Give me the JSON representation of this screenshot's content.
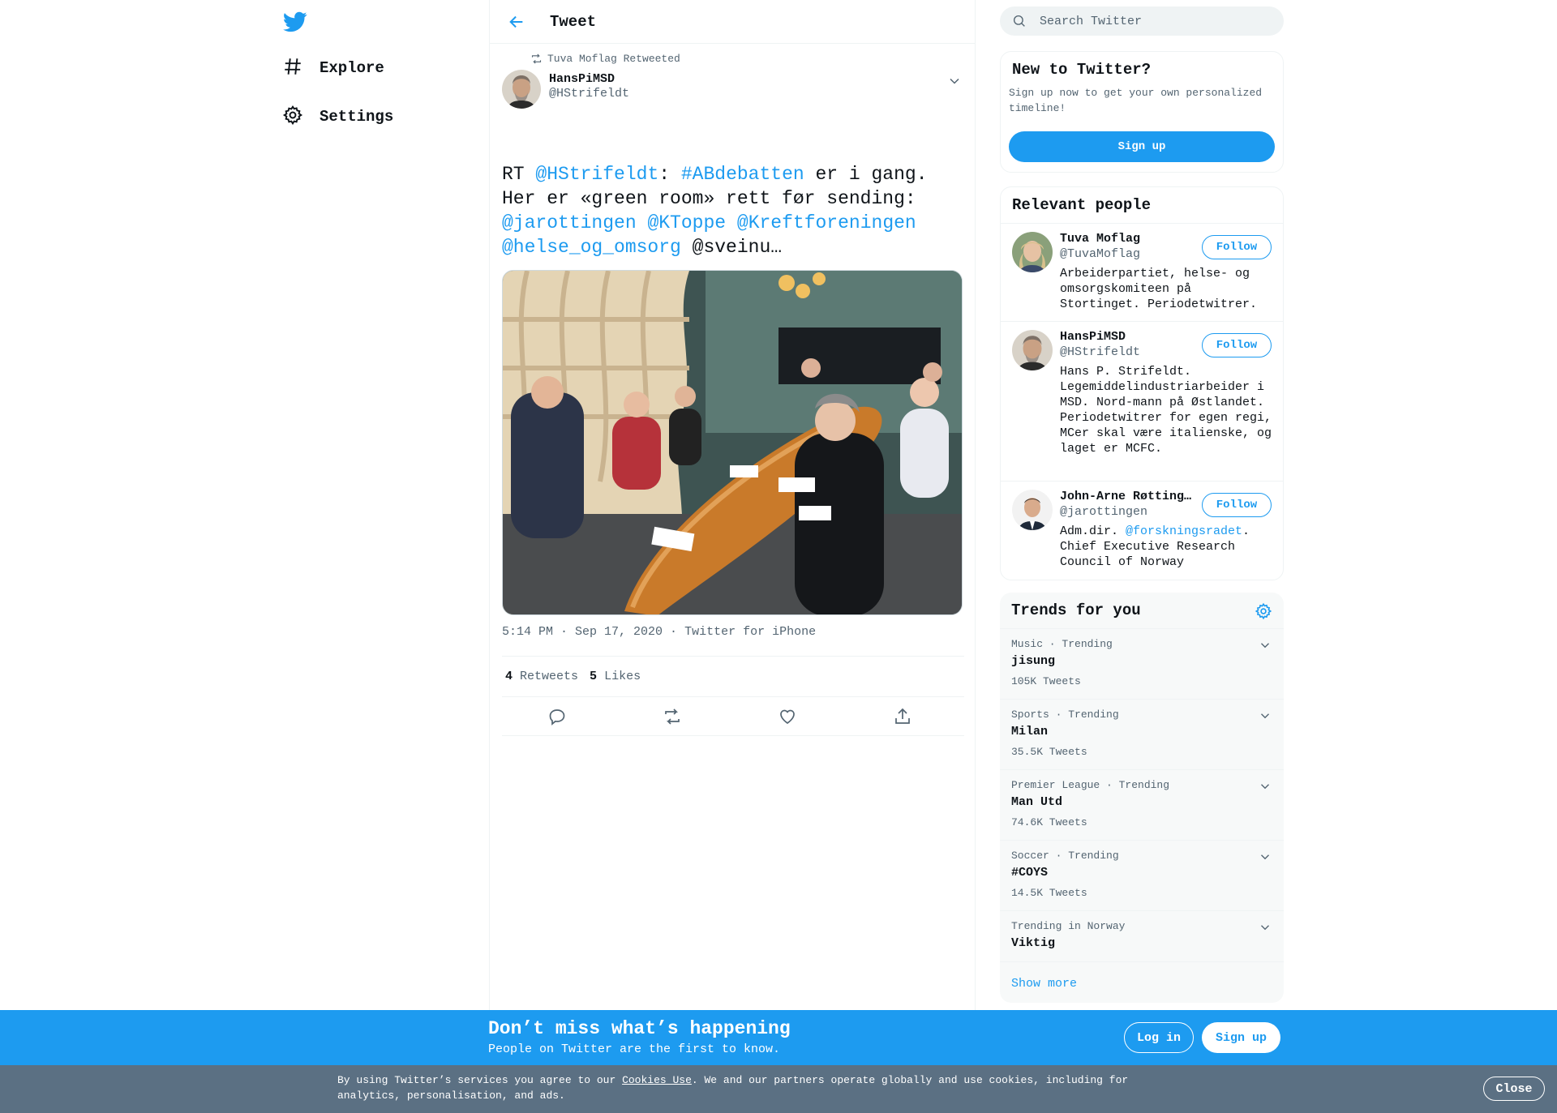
{
  "nav": {
    "logo_icon": "twitter-bird-icon",
    "items": [
      {
        "label": "Explore",
        "icon": "hashtag-icon"
      },
      {
        "label": "Settings",
        "icon": "gear-icon"
      }
    ]
  },
  "header": {
    "title": "Tweet",
    "back_icon": "arrow-left-icon"
  },
  "tweet": {
    "retweeted_by": "Tuva Moflag Retweeted",
    "author_name": "HansPiMSD",
    "author_handle": "@HStrifeldt",
    "text": {
      "rt": "RT ",
      "mention1": "@HStrifeldt",
      "colon": ": ",
      "hashtag": "#ABdebatten",
      "after_hashtag": " er i gang. Her er «green room» rett før sending: ",
      "mention2": "@jarottingen",
      "mention3": "@KToppe",
      "mention4": "@Kreftforeningen",
      "mention5": "@helse_og_omsorg",
      "tail": " @sveinu…"
    },
    "time": "5:14 PM · Sep 17, 2020",
    "sep": " · ",
    "source": "Twitter for iPhone",
    "retweets_count": "4",
    "retweets_label": "Retweets",
    "likes_count": "5",
    "likes_label": "Likes"
  },
  "search": {
    "placeholder": "Search Twitter"
  },
  "new_to_twitter": {
    "title": "New to Twitter?",
    "subtitle": "Sign up now to get your own personalized timeline!",
    "button": "Sign up"
  },
  "relevant_people": {
    "title": "Relevant people",
    "follow_label": "Follow",
    "people": [
      {
        "name": "Tuva Moflag",
        "handle": "@TuvaMoflag",
        "bio": "Arbeiderpartiet, helse- og omsorgskomiteen på Stortinget. Periodetwitrer."
      },
      {
        "name": "HansPiMSD",
        "handle": "@HStrifeldt",
        "bio": "Hans P. Strifeldt. Legemiddelindustriarbeider i MSD. Nord-mann på Østlandet. Periodetwitrer for egen regi, MCer skal være italienske, og laget er MCFC."
      },
      {
        "name": "John-Arne Røtting…",
        "handle": "@jarottingen",
        "bio_pre": "Adm.dir. ",
        "bio_link": "@forskningsradet",
        "bio_post": ". Chief Executive Research Council of Norway"
      }
    ]
  },
  "trends": {
    "title": "Trends for you",
    "items": [
      {
        "context": "Music · Trending",
        "name": "jisung",
        "count": "105K Tweets"
      },
      {
        "context": "Sports · Trending",
        "name": "Milan",
        "count": "35.5K Tweets"
      },
      {
        "context": "Premier League · Trending",
        "name": "Man Utd",
        "count": "74.6K Tweets"
      },
      {
        "context": "Soccer · Trending",
        "name": "#COYS",
        "count": "14.5K Tweets"
      },
      {
        "context": "Trending in Norway",
        "name": "Viktig",
        "count": ""
      }
    ],
    "show_more": "Show more"
  },
  "banner": {
    "title": "Don’t miss what’s happening",
    "subtitle": "People on Twitter are the first to know.",
    "login": "Log in",
    "signup": "Sign up"
  },
  "cookie": {
    "pre": "By using Twitter’s services you agree to our ",
    "link": "Cookies Use",
    "post": ". We and our partners operate globally and use cookies, including for analytics, personalisation, and ads.",
    "close": "Close"
  },
  "colors": {
    "accent": "#1d9bf0",
    "cookie_bar": "#5b7083",
    "muted": "#536471"
  }
}
